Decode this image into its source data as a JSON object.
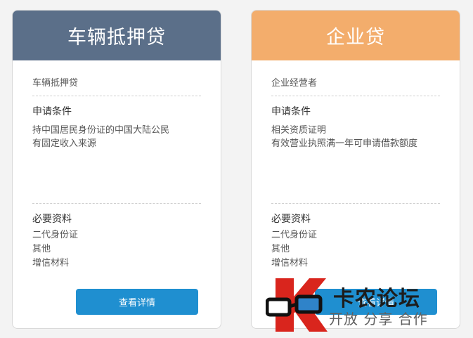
{
  "cards": [
    {
      "title": "车辆抵押贷",
      "subtitle": "车辆抵押贷",
      "conditions_title": "申请条件",
      "conditions": [
        "持中国居民身份证的中国大陆公民",
        "有固定收入来源"
      ],
      "materials_title": "必要资料",
      "materials": [
        "二代身份证",
        "其他",
        "增信材料"
      ],
      "button_label": "查看详情",
      "header_color": "#5b6f89"
    },
    {
      "title": "企业贷",
      "subtitle": "企业经营者",
      "conditions_title": "申请条件",
      "conditions": [
        "相关资质证明",
        "有效营业执照满一年可申请借款额度"
      ],
      "materials_title": "必要资料",
      "materials": [
        "二代身份证",
        "其他",
        "增信材料"
      ],
      "button_label": "查看详情",
      "header_color": "#f3ad6c"
    }
  ],
  "watermark": {
    "main": "卡农论坛",
    "sub": "开放 分享 合作"
  },
  "accent_button_color": "#1f8fd0"
}
